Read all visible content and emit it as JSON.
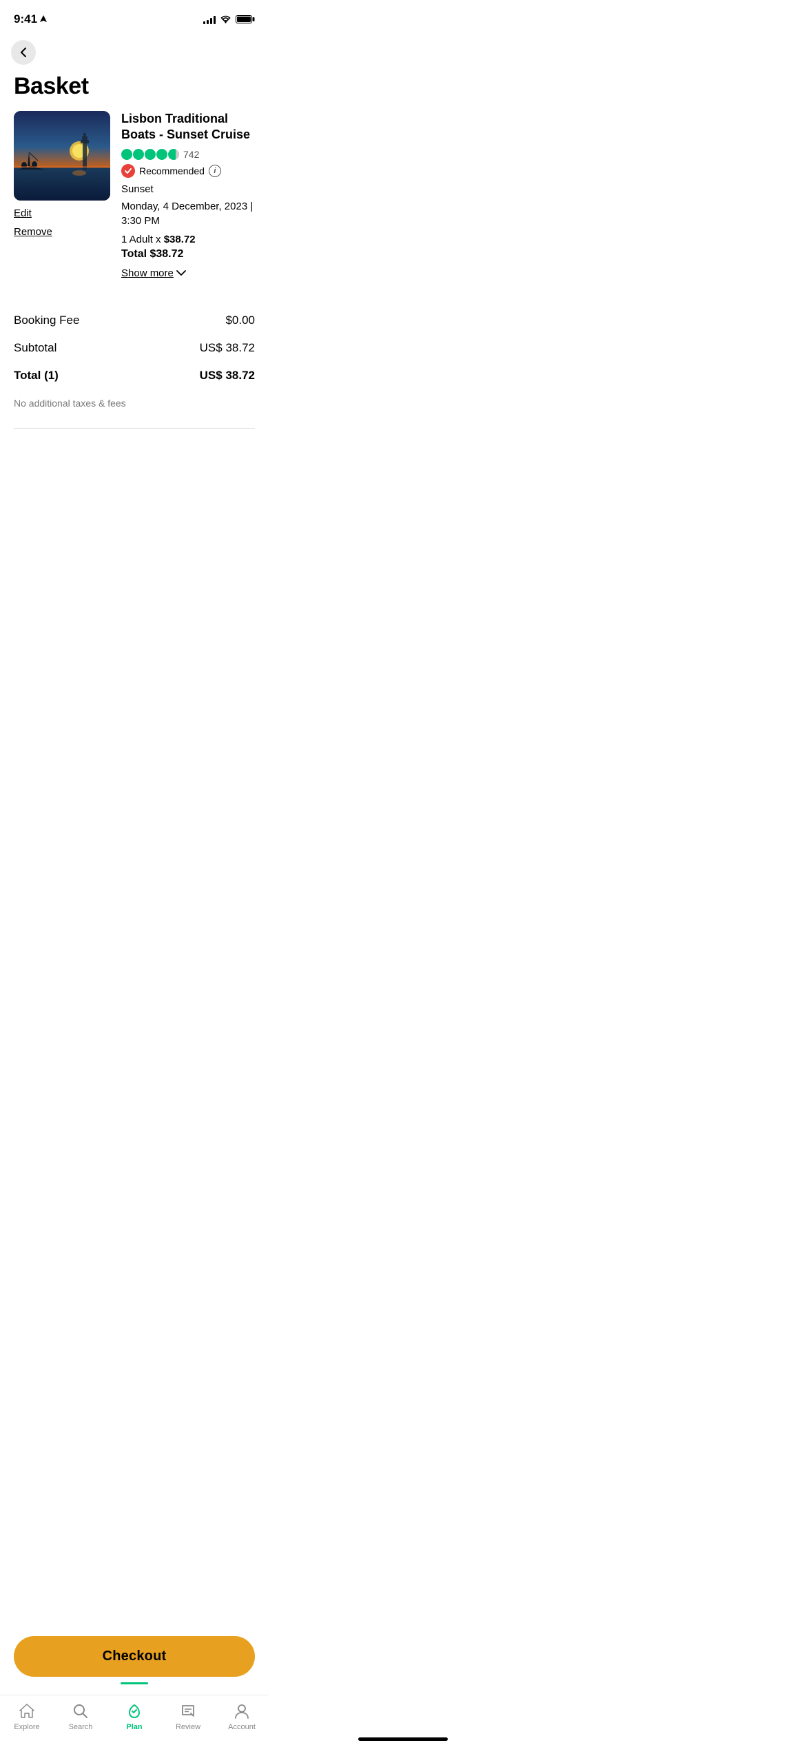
{
  "statusBar": {
    "time": "9:41",
    "locationIcon": "▶"
  },
  "header": {
    "backButton": "‹",
    "title": "Basket"
  },
  "item": {
    "title": "Lisbon Traditional Boats - Sunset Cruise",
    "ratingCount": "742",
    "recommendedLabel": "Recommended",
    "category": "Sunset",
    "date": "Monday, 4 December, 2023 | 3:30 PM",
    "pricePerAdult": "1 Adult x ",
    "pricePerValue": "$38.72",
    "totalLabel": "Total ",
    "totalValue": "$38.72",
    "showMoreLabel": "Show more",
    "editLabel": "Edit",
    "removeLabel": "Remove"
  },
  "summary": {
    "bookingFeeLabel": "Booking Fee",
    "bookingFeeValue": "$0.00",
    "subtotalLabel": "Subtotal",
    "subtotalValue": "US$ 38.72",
    "totalLabel": "Total (1)",
    "totalValue": "US$ 38.72",
    "taxNote": "No additional taxes & fees"
  },
  "checkout": {
    "buttonLabel": "Checkout"
  },
  "bottomNav": {
    "items": [
      {
        "id": "explore",
        "label": "Explore",
        "active": false
      },
      {
        "id": "search",
        "label": "Search",
        "active": false
      },
      {
        "id": "plan",
        "label": "Plan",
        "active": true
      },
      {
        "id": "review",
        "label": "Review",
        "active": false
      },
      {
        "id": "account",
        "label": "Account",
        "active": false
      }
    ]
  }
}
